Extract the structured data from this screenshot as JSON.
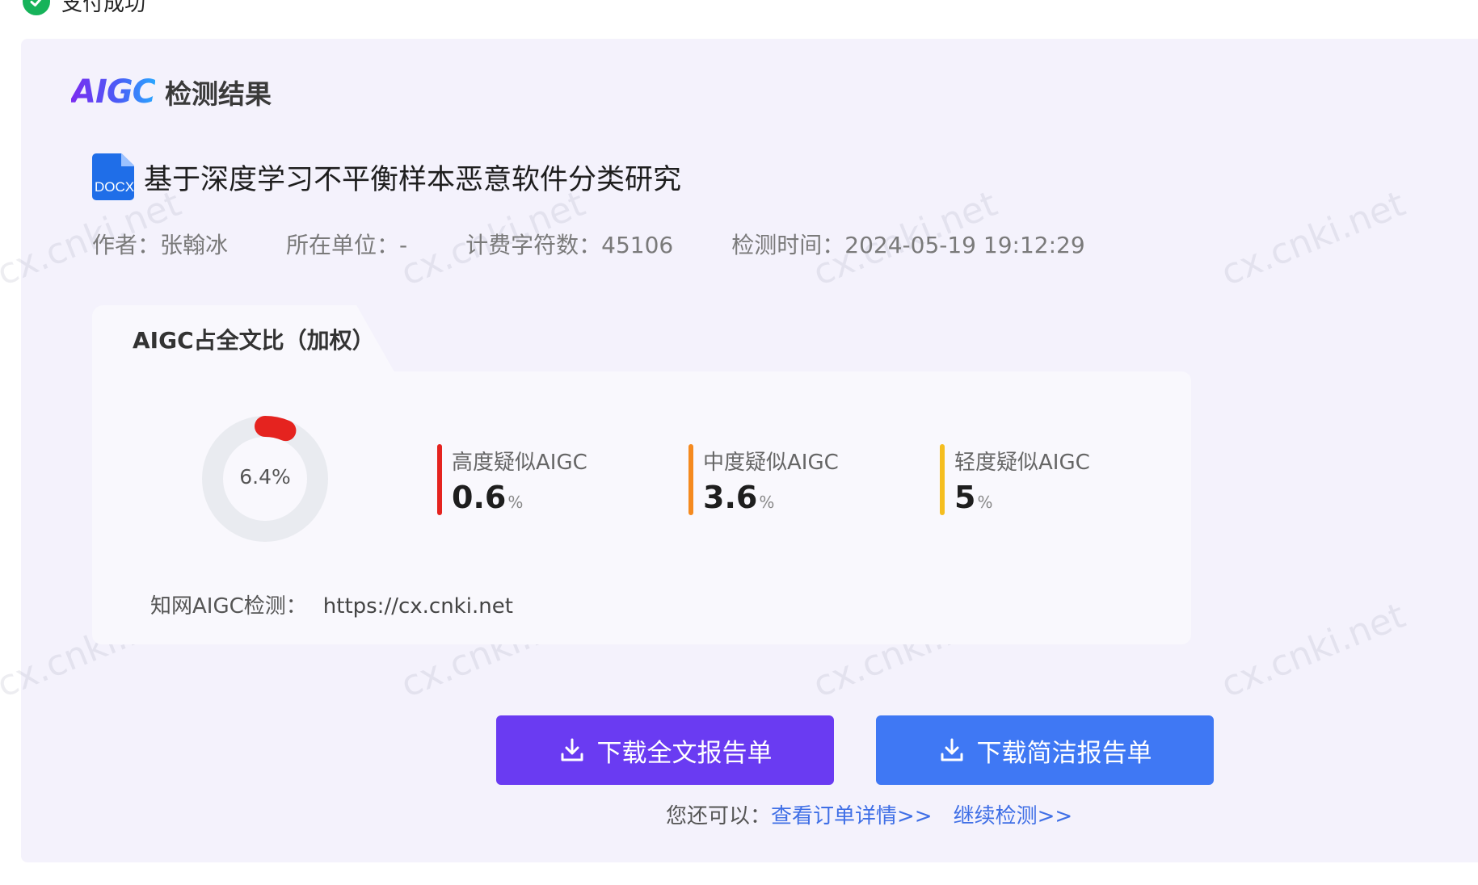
{
  "status": {
    "text": "支付成功"
  },
  "header": {
    "logo_text": "AIGC",
    "title": "检测结果"
  },
  "document": {
    "file_type": "DOCX",
    "title": "基于深度学习不平衡样本恶意软件分类研究"
  },
  "meta": {
    "author_label": "作者：",
    "author": "张翰冰",
    "unit_label": "所在单位：",
    "unit": "-",
    "chars_label": "计费字符数：",
    "chars": "45106",
    "time_label": "检测时间：",
    "time": "2024-05-19 19:12:29"
  },
  "result": {
    "tab_label": "AIGC占全文比（加权）",
    "total_percent": 6.4,
    "total_label": "6.4%",
    "ring_color": "#e5231f",
    "ring_track_color": "#e9ebf0",
    "metrics": [
      {
        "name": "高度疑似AIGC",
        "value": "0.6",
        "unit": "%",
        "color": "#e5231f"
      },
      {
        "name": "中度疑似AIGC",
        "value": "3.6",
        "unit": "%",
        "color": "#f58a1f"
      },
      {
        "name": "轻度疑似AIGC",
        "value": "5",
        "unit": "%",
        "color": "#f5be1f"
      }
    ]
  },
  "source": {
    "label": "知网AIGC检测：",
    "url": "https://cx.cnki.net"
  },
  "buttons": {
    "full_report": "下载全文报告单",
    "brief_report": "下载简洁报告单"
  },
  "more": {
    "prefix": "您还可以：",
    "order_link": "查看订单详情>>",
    "continue_link": "继续检测>>"
  },
  "watermark": {
    "text": "cx.cnki.net"
  }
}
